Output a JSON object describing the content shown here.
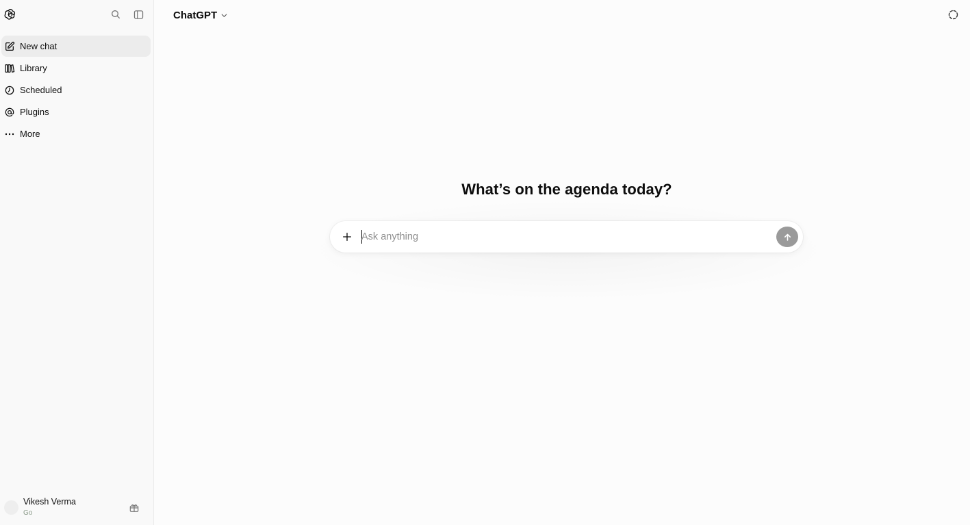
{
  "header": {
    "model_name": "ChatGPT"
  },
  "sidebar": {
    "items": [
      {
        "label": "New chat",
        "icon": "edit-icon"
      },
      {
        "label": "Library",
        "icon": "library-icon"
      },
      {
        "label": "Scheduled",
        "icon": "clock-icon"
      },
      {
        "label": "Plugins",
        "icon": "at-sign-icon"
      },
      {
        "label": "More",
        "icon": "more-dots-icon"
      }
    ],
    "profile": {
      "name": "Vikesh Verma",
      "plan": "Go"
    }
  },
  "main": {
    "headline": "What’s on the agenda today?",
    "composer": {
      "placeholder": "Ask anything",
      "value": ""
    }
  },
  "colors": {
    "background": "#fcfcfc",
    "sidebar": "#f9f9f9",
    "active_item": "#ececec",
    "send_button": "#9a9a9a"
  }
}
